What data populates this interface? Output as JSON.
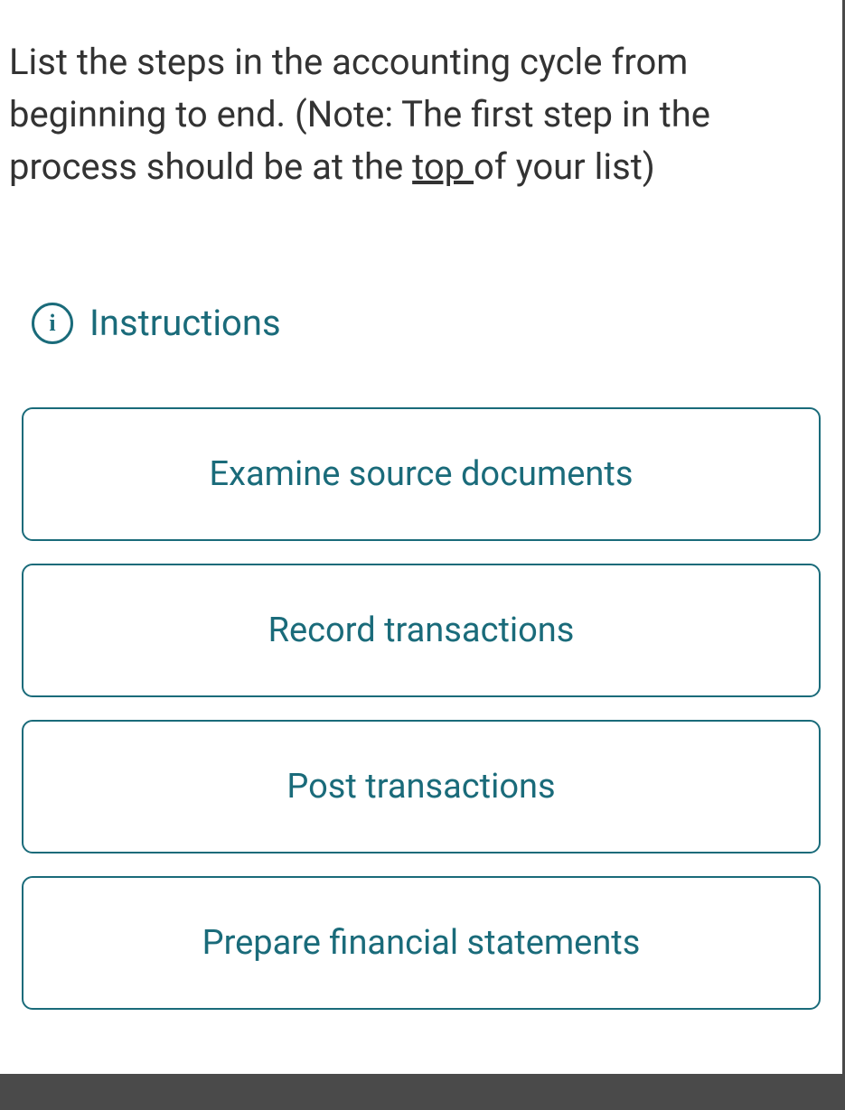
{
  "question": {
    "text_before_underline": "List the steps in the accounting cycle from beginning to end. (Note: The first step in the process should be at the ",
    "underlined": "top ",
    "text_after_underline": "of your list)"
  },
  "instructions": {
    "label": "Instructions",
    "icon_glyph": "i"
  },
  "items": [
    "Examine source documents",
    "Record transactions",
    "Post transactions",
    "Prepare financial statements"
  ]
}
